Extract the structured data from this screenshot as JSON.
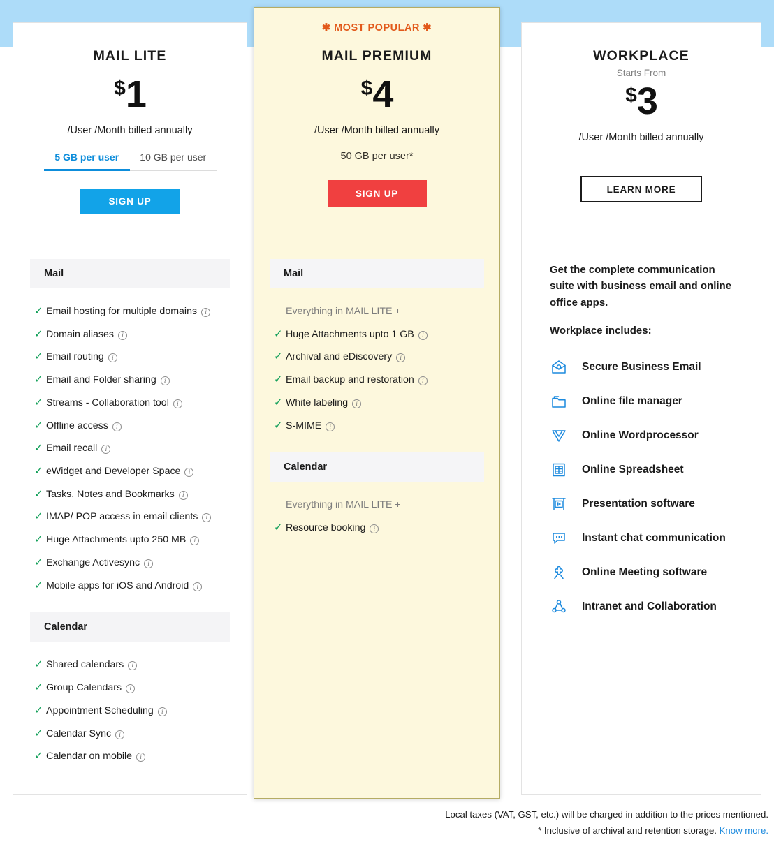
{
  "theme": {
    "band_blue": "#addcf9",
    "accent_blue": "#12a3e8",
    "accent_red": "#f04040",
    "accent_orange": "#e2591a",
    "check_green": "#13a05a",
    "premium_bg": "#fdf8dd",
    "link_blue": "#1c8ade"
  },
  "plans": {
    "lite": {
      "name": "MAIL LITE",
      "currency": "$",
      "price": "1",
      "billing": "/User /Month billed annually",
      "tabs": [
        {
          "label": "5 GB per user",
          "active": true
        },
        {
          "label": "10 GB per user",
          "active": false
        }
      ],
      "cta": "SIGN UP",
      "sections": [
        {
          "title": "Mail",
          "features": [
            {
              "label": "Email hosting for multiple domains",
              "info": true,
              "check": true
            },
            {
              "label": "Domain aliases",
              "info": true,
              "check": true
            },
            {
              "label": "Email routing",
              "info": true,
              "check": true
            },
            {
              "label": "Email and Folder sharing",
              "info": true,
              "check": true
            },
            {
              "label": "Streams - Collaboration tool",
              "info": true,
              "check": true
            },
            {
              "label": "Offline access",
              "info": true,
              "check": true
            },
            {
              "label": "Email recall",
              "info": true,
              "check": true
            },
            {
              "label": "eWidget and Developer Space",
              "info": true,
              "check": true
            },
            {
              "label": "Tasks, Notes and Bookmarks",
              "info": true,
              "check": true
            },
            {
              "label": "IMAP/ POP access in email clients",
              "info": true,
              "check": true
            },
            {
              "label": "Huge Attachments upto 250 MB",
              "info": true,
              "check": true
            },
            {
              "label": "Exchange Activesync",
              "info": true,
              "check": true
            },
            {
              "label": "Mobile apps for iOS and Android",
              "info": true,
              "check": true
            }
          ]
        },
        {
          "title": "Calendar",
          "features": [
            {
              "label": "Shared calendars",
              "info": true,
              "check": true
            },
            {
              "label": "Group Calendars",
              "info": true,
              "check": true
            },
            {
              "label": "Appointment Scheduling",
              "info": true,
              "check": true
            },
            {
              "label": "Calendar Sync",
              "info": true,
              "check": true
            },
            {
              "label": "Calendar on mobile",
              "info": true,
              "check": true
            }
          ]
        }
      ]
    },
    "premium": {
      "badge": "✱ MOST POPULAR ✱",
      "name": "MAIL PREMIUM",
      "currency": "$",
      "price": "4",
      "billing": "/User /Month billed annually",
      "storage": "50 GB per user*",
      "cta": "SIGN UP",
      "sections": [
        {
          "title": "Mail",
          "features": [
            {
              "label": "Everything in MAIL LITE +",
              "info": false,
              "check": false,
              "muted": true
            },
            {
              "label": "Huge Attachments upto 1 GB",
              "info": true,
              "check": true
            },
            {
              "label": "Archival and eDiscovery",
              "info": true,
              "check": true
            },
            {
              "label": "Email backup and restoration",
              "info": true,
              "check": true
            },
            {
              "label": "White labeling",
              "info": true,
              "check": true
            },
            {
              "label": "S-MIME",
              "info": true,
              "check": true
            }
          ]
        },
        {
          "title": "Calendar",
          "features": [
            {
              "label": "Everything in MAIL LITE +",
              "info": false,
              "check": false,
              "muted": true
            },
            {
              "label": "Resource booking",
              "info": true,
              "check": true
            }
          ]
        }
      ]
    },
    "workplace": {
      "name": "WORKPLACE",
      "starts_from": "Starts From",
      "currency": "$",
      "price": "3",
      "billing": "/User /Month billed annually",
      "cta": "LEARN MORE",
      "lead": "Get the complete communication suite with business email and online office apps.",
      "includes_title": "Workplace includes:",
      "items": [
        {
          "label": "Secure Business Email",
          "icon": "secure-email-icon"
        },
        {
          "label": "Online file manager",
          "icon": "file-manager-icon"
        },
        {
          "label": "Online Wordprocessor",
          "icon": "wordprocessor-icon"
        },
        {
          "label": "Online Spreadsheet",
          "icon": "spreadsheet-icon"
        },
        {
          "label": "Presentation software",
          "icon": "presentation-icon"
        },
        {
          "label": "Instant chat communication",
          "icon": "chat-icon"
        },
        {
          "label": "Online Meeting software",
          "icon": "meeting-icon"
        },
        {
          "label": "Intranet and Collaboration",
          "icon": "intranet-icon"
        }
      ]
    }
  },
  "footer": {
    "line1": "Local taxes (VAT, GST, etc.) will be charged in addition to the prices mentioned.",
    "line2": "* Inclusive of archival and retention storage.",
    "link": "Know more."
  }
}
